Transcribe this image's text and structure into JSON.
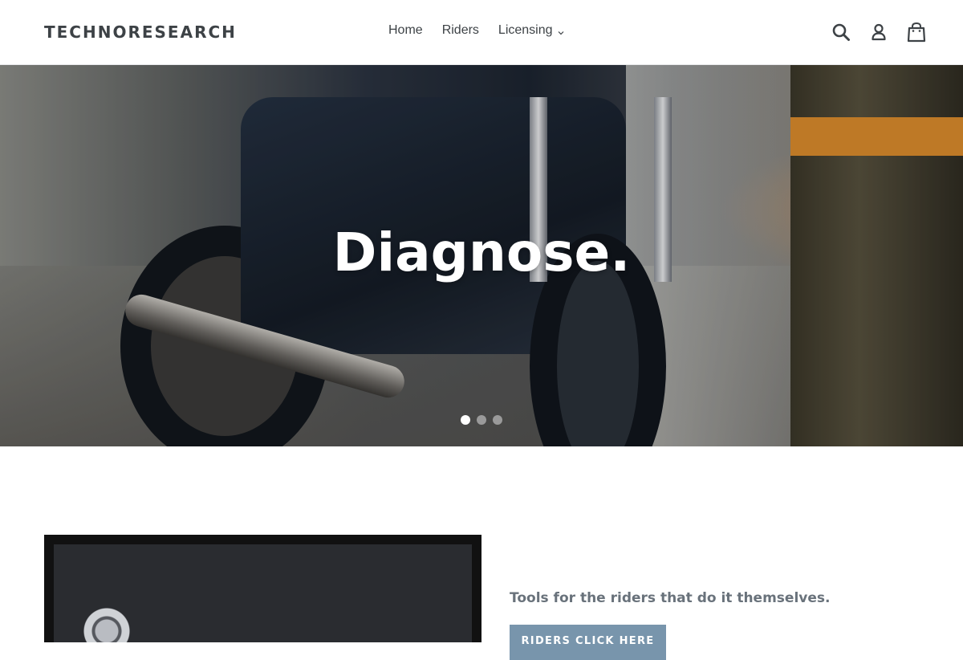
{
  "header": {
    "logo": "TECHNORESEARCH",
    "nav": [
      {
        "label": "Home"
      },
      {
        "label": "Riders"
      },
      {
        "label": "Licensing",
        "has_dropdown": true
      }
    ],
    "icons": [
      "search-icon",
      "account-icon",
      "cart-icon"
    ]
  },
  "hero": {
    "title": "Diagnose.",
    "slides": 3,
    "active_slide": 1
  },
  "feature": {
    "tagline": "Tools for the riders that do it themselves.",
    "button_label": "RIDERS CLICK HERE"
  },
  "colors": {
    "text": "#3d4246",
    "button": "#7895ac",
    "tagline": "#69727b",
    "accent_orange": "#d98a2c"
  }
}
